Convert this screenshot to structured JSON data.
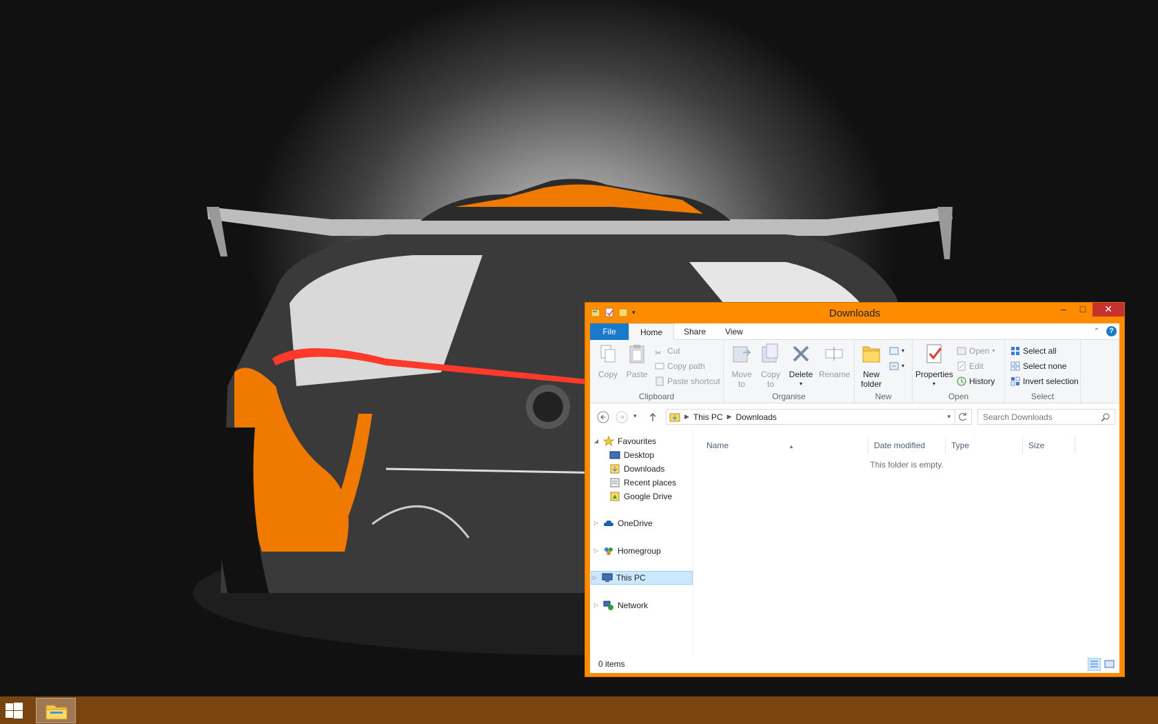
{
  "taskbar": {
    "start_icon": "windows-logo-icon",
    "pinned": [
      {
        "name": "file-explorer",
        "icon": "folder-icon"
      }
    ],
    "accent_color": "#7a4410"
  },
  "window": {
    "title": "Downloads",
    "frame_color": "#ff8c00",
    "controls": {
      "minimize": "–",
      "maximize": "□",
      "close": "✕"
    },
    "tabs": {
      "file": "File",
      "home": "Home",
      "share": "Share",
      "view": "View"
    },
    "help_label": "?",
    "ribbon": {
      "clipboard": {
        "label": "Clipboard",
        "copy": "Copy",
        "paste": "Paste",
        "cut": "Cut",
        "copy_path": "Copy path",
        "paste_shortcut": "Paste shortcut"
      },
      "organise": {
        "label": "Organise",
        "move_to_1": "Move",
        "move_to_2": "to",
        "copy_to_1": "Copy",
        "copy_to_2": "to",
        "delete": "Delete",
        "rename": "Rename"
      },
      "new": {
        "label": "New",
        "new_folder_1": "New",
        "new_folder_2": "folder"
      },
      "open": {
        "label": "Open",
        "properties": "Properties",
        "open": "Open",
        "edit": "Edit",
        "history": "History"
      },
      "select": {
        "label": "Select",
        "select_all": "Select all",
        "select_none": "Select none",
        "invert_selection": "Invert selection"
      }
    },
    "address": {
      "crumbs": [
        "This PC",
        "Downloads"
      ],
      "search_placeholder": "Search Downloads"
    },
    "navpane": {
      "favourites": "Favourites",
      "favourites_items": [
        "Desktop",
        "Downloads",
        "Recent places",
        "Google Drive"
      ],
      "onedrive": "OneDrive",
      "homegroup": "Homegroup",
      "this_pc": "This PC",
      "network": "Network"
    },
    "columns": {
      "name": "Name",
      "date_modified": "Date modified",
      "type": "Type",
      "size": "Size"
    },
    "empty_message": "This folder is empty.",
    "status": "0 items"
  }
}
